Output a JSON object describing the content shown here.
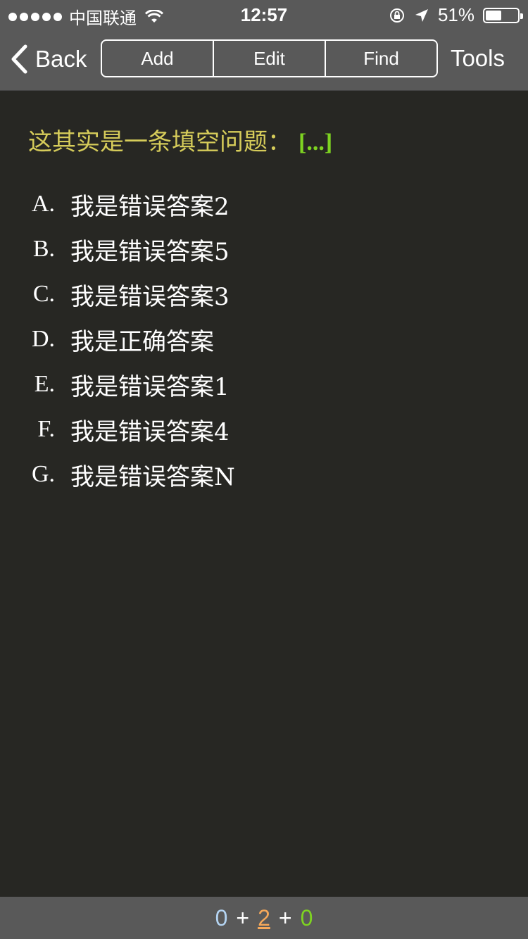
{
  "status_bar": {
    "carrier": "中国联通",
    "time": "12:57",
    "battery": "51%",
    "battery_level": 0.51
  },
  "nav": {
    "back_label": "Back",
    "segments": [
      "Add",
      "Edit",
      "Find"
    ],
    "tools_label": "Tools"
  },
  "question": {
    "text": "这其实是一条填空问题：",
    "blank": "[...]"
  },
  "options": [
    {
      "letter": "A.",
      "text": "我是错误答案2"
    },
    {
      "letter": "B.",
      "text": "我是错误答案5"
    },
    {
      "letter": "C.",
      "text": "我是错误答案3"
    },
    {
      "letter": "D.",
      "text": "我是正确答案"
    },
    {
      "letter": "E.",
      "text": "我是错误答案1"
    },
    {
      "letter": "F.",
      "text": "我是错误答案4"
    },
    {
      "letter": "G.",
      "text": "我是错误答案N"
    }
  ],
  "score": {
    "first": "0",
    "plus1": "+",
    "second": "2",
    "plus2": "+",
    "third": "0"
  },
  "colors": {
    "question": "#d6cc5a",
    "blank": "#7ed321",
    "score_first": "#b4d4f2",
    "score_second": "#f5a85a",
    "score_third": "#7ed321"
  }
}
